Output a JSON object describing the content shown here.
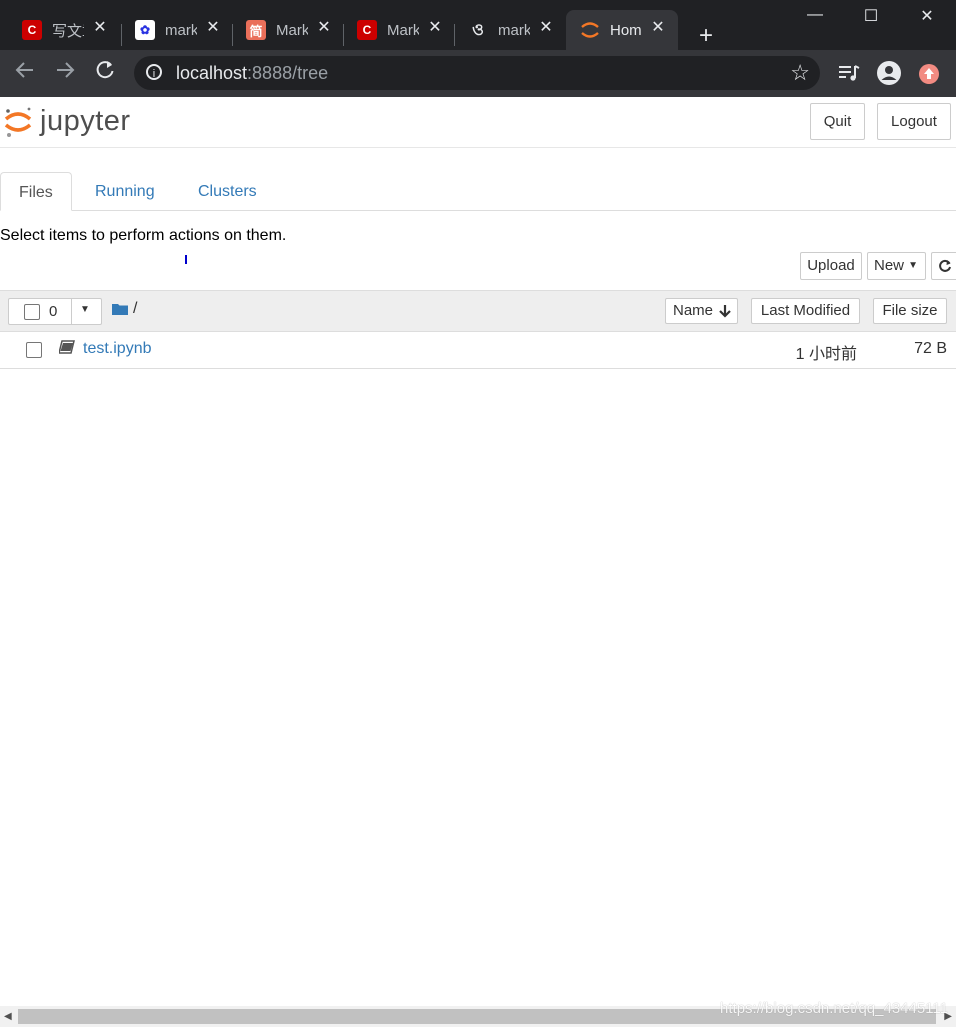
{
  "browser": {
    "tabs": [
      {
        "title": "写文章",
        "icon": "csdn-icon",
        "active": false
      },
      {
        "title": "markdown",
        "icon": "baidu-icon",
        "active": false
      },
      {
        "title": "Markdown",
        "icon": "jianshu-icon",
        "active": false
      },
      {
        "title": "Markdown",
        "icon": "csdn-icon",
        "active": false
      },
      {
        "title": "markdown",
        "icon": "site-icon",
        "active": false
      },
      {
        "title": "Home",
        "icon": "jupyter-icon",
        "active": true
      }
    ],
    "tab_close": "✕",
    "new_tab": "+",
    "window": {
      "minimize": "—",
      "maximize": "☐",
      "close": "✕"
    },
    "url_host": "localhost",
    "url_rest": ":8888/tree"
  },
  "header": {
    "logo_text": "jupyter",
    "quit_label": "Quit",
    "logout_label": "Logout"
  },
  "tabs": [
    {
      "label": "Files"
    },
    {
      "label": "Running"
    },
    {
      "label": "Clusters"
    }
  ],
  "toolbar": {
    "hint": "Select items to perform actions on them.",
    "upload_label": "Upload",
    "new_label": "New"
  },
  "list_header": {
    "selected_count": "0",
    "path": "/",
    "name_label": "Name",
    "modified_label": "Last Modified",
    "size_label": "File size"
  },
  "files": [
    {
      "name": "test.ipynb",
      "modified": "1 小时前",
      "size": "72 B"
    }
  ],
  "watermark": "https://blog.csdn.net/qq_43445111",
  "colors": {
    "accent": "#F37726",
    "link": "#337ab7"
  }
}
